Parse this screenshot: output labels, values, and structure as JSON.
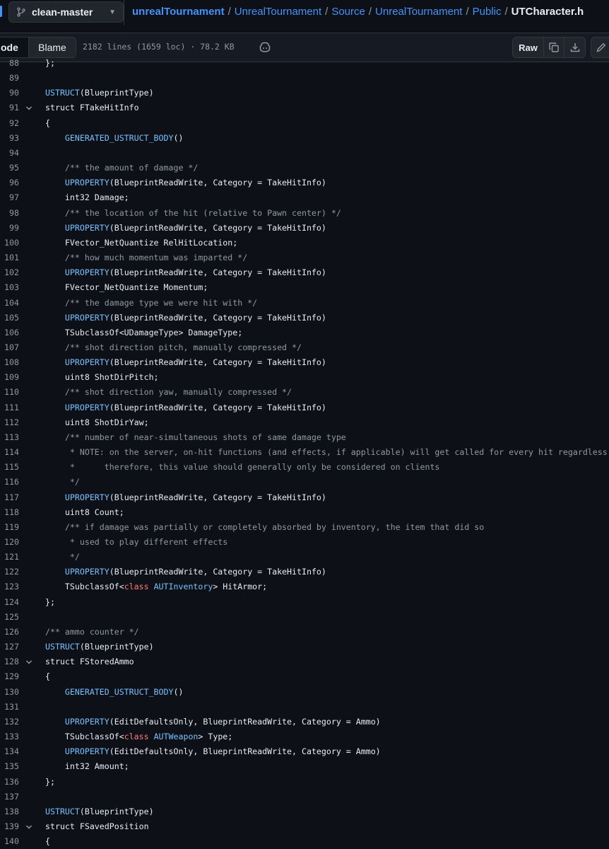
{
  "header": {
    "branch": "clean-master",
    "breadcrumb": [
      "unrealTournament",
      "UnrealTournament",
      "Source",
      "UnrealTournament",
      "Public"
    ],
    "file": "UTCharacter.h"
  },
  "toolbar": {
    "code_label": "ode",
    "blame_label": "Blame",
    "file_info": "2182 lines (1659 loc) · 78.2 KB",
    "raw_label": "Raw"
  },
  "colors": {
    "background": "#0d1117",
    "link": "#4493f8",
    "keyword": "#ff7b72",
    "macro": "#79c0ff",
    "comment": "#9198a1"
  },
  "code": {
    "lines": [
      {
        "n": "88",
        "fold": false,
        "tokens": [
          [
            "p",
            "};"
          ]
        ]
      },
      {
        "n": "89",
        "fold": false,
        "tokens": []
      },
      {
        "n": "90",
        "fold": false,
        "tokens": [
          [
            "m",
            "USTRUCT"
          ],
          [
            "p",
            "(BlueprintType)"
          ]
        ]
      },
      {
        "n": "91",
        "fold": true,
        "tokens": [
          [
            "p",
            "struct FTakeHitInfo"
          ]
        ]
      },
      {
        "n": "92",
        "fold": false,
        "tokens": [
          [
            "p",
            "{"
          ]
        ]
      },
      {
        "n": "93",
        "fold": false,
        "tokens": [
          [
            "p",
            "    "
          ],
          [
            "m",
            "GENERATED_USTRUCT_BODY"
          ],
          [
            "p",
            "()"
          ]
        ]
      },
      {
        "n": "94",
        "fold": false,
        "tokens": []
      },
      {
        "n": "95",
        "fold": false,
        "tokens": [
          [
            "p",
            "    "
          ],
          [
            "c",
            "/** the amount of damage */"
          ]
        ]
      },
      {
        "n": "96",
        "fold": false,
        "tokens": [
          [
            "p",
            "    "
          ],
          [
            "m",
            "UPROPERTY"
          ],
          [
            "p",
            "(BlueprintReadWrite, Category = TakeHitInfo)"
          ]
        ]
      },
      {
        "n": "97",
        "fold": false,
        "tokens": [
          [
            "p",
            "    int32 Damage;"
          ]
        ]
      },
      {
        "n": "98",
        "fold": false,
        "tokens": [
          [
            "p",
            "    "
          ],
          [
            "c",
            "/** the location of the hit (relative to Pawn center) */"
          ]
        ]
      },
      {
        "n": "99",
        "fold": false,
        "tokens": [
          [
            "p",
            "    "
          ],
          [
            "m",
            "UPROPERTY"
          ],
          [
            "p",
            "(BlueprintReadWrite, Category = TakeHitInfo)"
          ]
        ]
      },
      {
        "n": "100",
        "fold": false,
        "tokens": [
          [
            "p",
            "    FVector_NetQuantize RelHitLocation;"
          ]
        ]
      },
      {
        "n": "101",
        "fold": false,
        "tokens": [
          [
            "p",
            "    "
          ],
          [
            "c",
            "/** how much momentum was imparted */"
          ]
        ]
      },
      {
        "n": "102",
        "fold": false,
        "tokens": [
          [
            "p",
            "    "
          ],
          [
            "m",
            "UPROPERTY"
          ],
          [
            "p",
            "(BlueprintReadWrite, Category = TakeHitInfo)"
          ]
        ]
      },
      {
        "n": "103",
        "fold": false,
        "tokens": [
          [
            "p",
            "    FVector_NetQuantize Momentum;"
          ]
        ]
      },
      {
        "n": "104",
        "fold": false,
        "tokens": [
          [
            "p",
            "    "
          ],
          [
            "c",
            "/** the damage type we were hit with */"
          ]
        ]
      },
      {
        "n": "105",
        "fold": false,
        "tokens": [
          [
            "p",
            "    "
          ],
          [
            "m",
            "UPROPERTY"
          ],
          [
            "p",
            "(BlueprintReadWrite, Category = TakeHitInfo)"
          ]
        ]
      },
      {
        "n": "106",
        "fold": false,
        "tokens": [
          [
            "p",
            "    TSubclassOf<UDamageType> DamageType;"
          ]
        ]
      },
      {
        "n": "107",
        "fold": false,
        "tokens": [
          [
            "p",
            "    "
          ],
          [
            "c",
            "/** shot direction pitch, manually compressed */"
          ]
        ]
      },
      {
        "n": "108",
        "fold": false,
        "tokens": [
          [
            "p",
            "    "
          ],
          [
            "m",
            "UPROPERTY"
          ],
          [
            "p",
            "(BlueprintReadWrite, Category = TakeHitInfo)"
          ]
        ]
      },
      {
        "n": "109",
        "fold": false,
        "tokens": [
          [
            "p",
            "    uint8 ShotDirPitch;"
          ]
        ]
      },
      {
        "n": "110",
        "fold": false,
        "tokens": [
          [
            "p",
            "    "
          ],
          [
            "c",
            "/** shot direction yaw, manually compressed */"
          ]
        ]
      },
      {
        "n": "111",
        "fold": false,
        "tokens": [
          [
            "p",
            "    "
          ],
          [
            "m",
            "UPROPERTY"
          ],
          [
            "p",
            "(BlueprintReadWrite, Category = TakeHitInfo)"
          ]
        ]
      },
      {
        "n": "112",
        "fold": false,
        "tokens": [
          [
            "p",
            "    uint8 ShotDirYaw;"
          ]
        ]
      },
      {
        "n": "113",
        "fold": false,
        "tokens": [
          [
            "p",
            "    "
          ],
          [
            "c",
            "/** number of near-simultaneous shots of same damage type"
          ]
        ]
      },
      {
        "n": "114",
        "fold": false,
        "tokens": [
          [
            "p",
            "    "
          ],
          [
            "c",
            " * NOTE: on the server, on-hit functions (and effects, if applicable) will get called for every hit regardless"
          ]
        ]
      },
      {
        "n": "115",
        "fold": false,
        "tokens": [
          [
            "p",
            "    "
          ],
          [
            "c",
            " *      therefore, this value should generally only be considered on clients"
          ]
        ]
      },
      {
        "n": "116",
        "fold": false,
        "tokens": [
          [
            "p",
            "    "
          ],
          [
            "c",
            " */"
          ]
        ]
      },
      {
        "n": "117",
        "fold": false,
        "tokens": [
          [
            "p",
            "    "
          ],
          [
            "m",
            "UPROPERTY"
          ],
          [
            "p",
            "(BlueprintReadWrite, Category = TakeHitInfo)"
          ]
        ]
      },
      {
        "n": "118",
        "fold": false,
        "tokens": [
          [
            "p",
            "    uint8 Count;"
          ]
        ]
      },
      {
        "n": "119",
        "fold": false,
        "tokens": [
          [
            "p",
            "    "
          ],
          [
            "c",
            "/** if damage was partially or completely absorbed by inventory, the item that did so"
          ]
        ]
      },
      {
        "n": "120",
        "fold": false,
        "tokens": [
          [
            "p",
            "    "
          ],
          [
            "c",
            " * used to play different effects"
          ]
        ]
      },
      {
        "n": "121",
        "fold": false,
        "tokens": [
          [
            "p",
            "    "
          ],
          [
            "c",
            " */"
          ]
        ]
      },
      {
        "n": "122",
        "fold": false,
        "tokens": [
          [
            "p",
            "    "
          ],
          [
            "m",
            "UPROPERTY"
          ],
          [
            "p",
            "(BlueprintReadWrite, Category = TakeHitInfo)"
          ]
        ]
      },
      {
        "n": "123",
        "fold": false,
        "tokens": [
          [
            "p",
            "    TSubclassOf<"
          ],
          [
            "k",
            "class"
          ],
          [
            "p",
            " "
          ],
          [
            "m",
            "AUTInventory"
          ],
          [
            "p",
            "> HitArmor;"
          ]
        ]
      },
      {
        "n": "124",
        "fold": false,
        "tokens": [
          [
            "p",
            "};"
          ]
        ]
      },
      {
        "n": "125",
        "fold": false,
        "tokens": []
      },
      {
        "n": "126",
        "fold": false,
        "tokens": [
          [
            "c",
            "/** ammo counter */"
          ]
        ]
      },
      {
        "n": "127",
        "fold": false,
        "tokens": [
          [
            "m",
            "USTRUCT"
          ],
          [
            "p",
            "(BlueprintType)"
          ]
        ]
      },
      {
        "n": "128",
        "fold": true,
        "tokens": [
          [
            "p",
            "struct FStoredAmmo"
          ]
        ]
      },
      {
        "n": "129",
        "fold": false,
        "tokens": [
          [
            "p",
            "{"
          ]
        ]
      },
      {
        "n": "130",
        "fold": false,
        "tokens": [
          [
            "p",
            "    "
          ],
          [
            "m",
            "GENERATED_USTRUCT_BODY"
          ],
          [
            "p",
            "()"
          ]
        ]
      },
      {
        "n": "131",
        "fold": false,
        "tokens": []
      },
      {
        "n": "132",
        "fold": false,
        "tokens": [
          [
            "p",
            "    "
          ],
          [
            "m",
            "UPROPERTY"
          ],
          [
            "p",
            "(EditDefaultsOnly, BlueprintReadWrite, Category = Ammo)"
          ]
        ]
      },
      {
        "n": "133",
        "fold": false,
        "tokens": [
          [
            "p",
            "    TSubclassOf<"
          ],
          [
            "k",
            "class"
          ],
          [
            "p",
            " "
          ],
          [
            "m",
            "AUTWeapon"
          ],
          [
            "p",
            "> Type;"
          ]
        ]
      },
      {
        "n": "134",
        "fold": false,
        "tokens": [
          [
            "p",
            "    "
          ],
          [
            "m",
            "UPROPERTY"
          ],
          [
            "p",
            "(EditDefaultsOnly, BlueprintReadWrite, Category = Ammo)"
          ]
        ]
      },
      {
        "n": "135",
        "fold": false,
        "tokens": [
          [
            "p",
            "    int32 Amount;"
          ]
        ]
      },
      {
        "n": "136",
        "fold": false,
        "tokens": [
          [
            "p",
            "};"
          ]
        ]
      },
      {
        "n": "137",
        "fold": false,
        "tokens": []
      },
      {
        "n": "138",
        "fold": false,
        "tokens": [
          [
            "m",
            "USTRUCT"
          ],
          [
            "p",
            "(BlueprintType)"
          ]
        ]
      },
      {
        "n": "139",
        "fold": true,
        "tokens": [
          [
            "p",
            "struct FSavedPosition"
          ]
        ]
      },
      {
        "n": "140",
        "fold": false,
        "tokens": [
          [
            "p",
            "{"
          ]
        ]
      }
    ]
  }
}
